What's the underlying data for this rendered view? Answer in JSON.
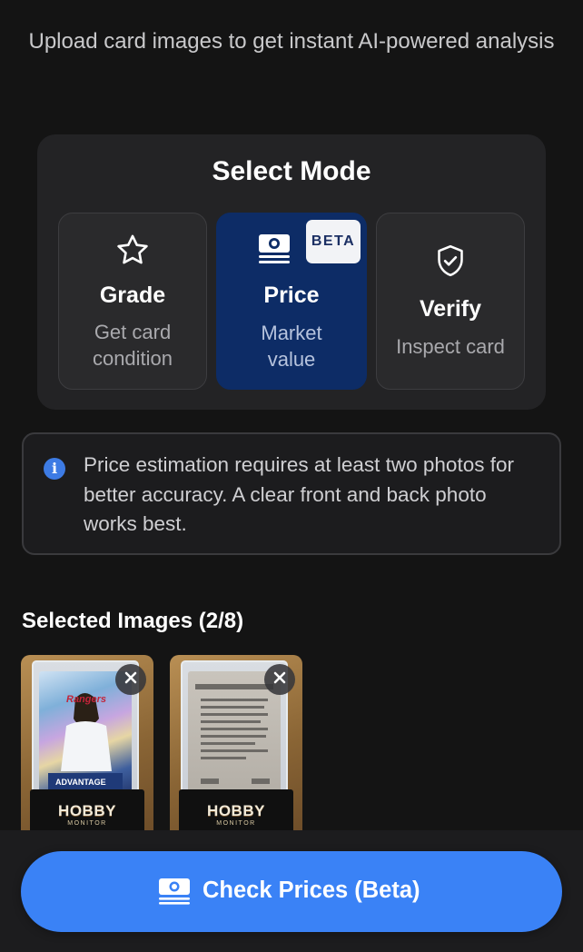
{
  "header": {
    "subtitle": "Upload card images to get instant AI-powered analysis"
  },
  "mode_selector": {
    "title": "Select Mode",
    "selected": "Price",
    "modes": [
      {
        "label": "Grade",
        "description": "Get card condition",
        "icon": "star-icon"
      },
      {
        "label": "Price",
        "description": "Market value",
        "icon": "money-icon",
        "badge": "BETA"
      },
      {
        "label": "Verify",
        "description": "Inspect card",
        "icon": "shield-check-icon"
      }
    ]
  },
  "info_notice": {
    "icon": "info-icon",
    "text": "Price estimation requires at least two photos for better accuracy. A clear front and back photo works best."
  },
  "selected_images": {
    "title": "Selected Images (2/8)",
    "images": [
      {
        "description": "card front in slab",
        "stand_logo": "HOBBY",
        "stand_logo_sub": "MONITOR",
        "remove_icon": "close-icon"
      },
      {
        "description": "card back in slab",
        "stand_logo": "HOBBY",
        "stand_logo_sub": "MONITOR",
        "remove_icon": "close-icon"
      }
    ]
  },
  "action": {
    "label": "Check Prices (Beta)",
    "icon": "money-icon"
  },
  "colors": {
    "background": "#141414",
    "panel": "#232325",
    "selected_mode": "#0d2c66",
    "accent": "#3a82f6",
    "info": "#3d7be4"
  }
}
